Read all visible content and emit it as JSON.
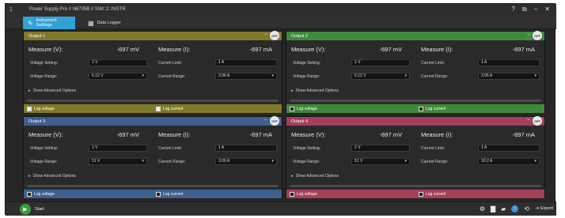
{
  "window": {
    "app_icon": "1",
    "title": "Power Supply Pro // N6705B // SIM::2::INSTR"
  },
  "title_controls": {
    "help": "?",
    "restore": "⧉",
    "minimize": "−",
    "close": "✕"
  },
  "tabs": [
    {
      "label": "Instrument Settings",
      "icon": "✎"
    },
    {
      "label": "Data Logger",
      "icon": "▦"
    }
  ],
  "panels": [
    {
      "name": "Output 1",
      "measure_v_label": "Measure (V):",
      "measure_v": "-697 mV",
      "measure_i_label": "Measure (I):",
      "measure_i": "-697 mA",
      "voltage_setting_label": "Voltage Setting:",
      "voltage_setting": "1 V",
      "current_limit_label": "Current Limit:",
      "current_limit": "1 A",
      "voltage_range_label": "Voltage Range:",
      "voltage_range": "6.12 V",
      "current_range_label": "Current Range:",
      "current_range": "3.06 A",
      "advanced": "Show Advanced Options",
      "log_voltage": "Log voltage",
      "log_current": "Log current",
      "toggle": "OFF"
    },
    {
      "name": "Output 2",
      "measure_v_label": "Measure (V):",
      "measure_v": "-697 mV",
      "measure_i_label": "Measure (I):",
      "measure_i": "-697 mA",
      "voltage_setting_label": "Voltage Setting:",
      "voltage_setting": "1 V",
      "current_limit_label": "Current Limit:",
      "current_limit": "1 A",
      "voltage_range_label": "Voltage Range:",
      "voltage_range": "6.12 V",
      "current_range_label": "Current Range:",
      "current_range": "3.06 A",
      "advanced": "Show Advanced Options",
      "log_voltage": "Log voltage",
      "log_current": "Log current",
      "toggle": "OFF"
    },
    {
      "name": "Output 3",
      "measure_v_label": "Measure (V):",
      "measure_v": "-697 mV",
      "measure_i_label": "Measure (I):",
      "measure_i": "-697 mA",
      "voltage_setting_label": "Voltage Setting:",
      "voltage_setting": "1 V",
      "current_limit_label": "Current Limit:",
      "current_limit": "1 A",
      "voltage_range_label": "Voltage Range:",
      "voltage_range": "51 V",
      "current_range_label": "Current Range:",
      "current_range": "3.06 A",
      "advanced": "Show Advanced Options",
      "log_voltage": "Log voltage",
      "log_current": "Log current",
      "toggle": "OFF"
    },
    {
      "name": "Output 4",
      "measure_v_label": "Measure (V):",
      "measure_v": "-697 mV",
      "measure_i_label": "Measure (I):",
      "measure_i": "-697 mA",
      "voltage_setting_label": "Voltage Setting:",
      "voltage_setting": "1 V",
      "current_limit_label": "Current Limit:",
      "current_limit": "1 A",
      "voltage_range_label": "Voltage Range:",
      "voltage_range": "51 V",
      "current_range_label": "Current Range:",
      "current_range": "10.2 A",
      "advanced": "Show Advanced Options",
      "log_voltage": "Log voltage",
      "log_current": "Log current",
      "toggle": "OFF"
    }
  ],
  "bottom": {
    "start_label": "Start",
    "start_icon": "▶",
    "export_label": "Export",
    "export_icon": "⇥",
    "icons": {
      "settings": "⚙",
      "save": "▇",
      "open": "▰",
      "info": "i",
      "history": "⟲"
    }
  }
}
